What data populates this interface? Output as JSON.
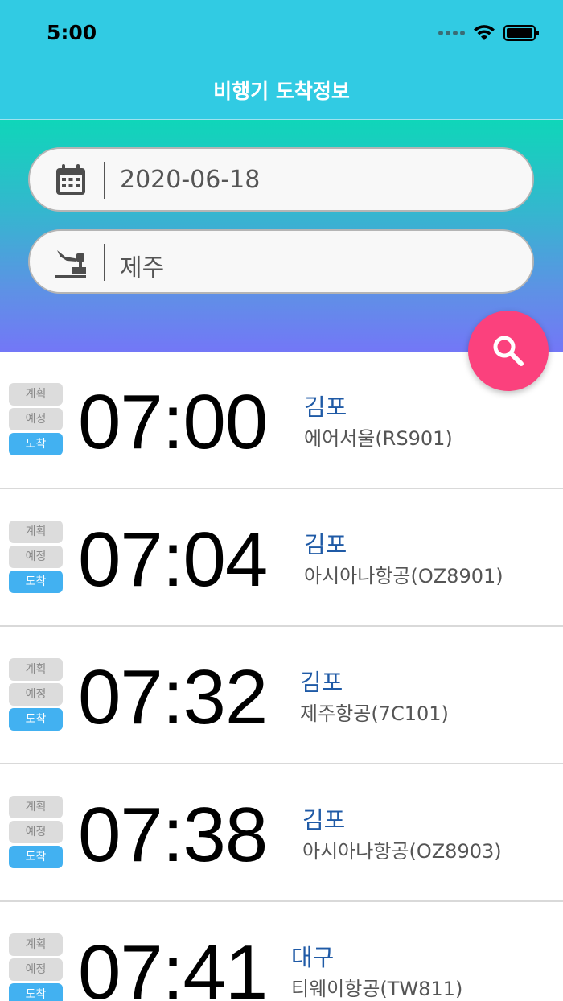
{
  "status_bar": {
    "time": "5:00"
  },
  "nav": {
    "title": "비행기 도착정보"
  },
  "search": {
    "date": "2020-06-18",
    "airport": "제주",
    "date_icon": "calendar-icon",
    "airport_icon": "airplane-arrival-icon",
    "search_icon": "search-icon"
  },
  "colors": {
    "topbar": "#31cbe3",
    "gradient_top": "#0fd6b9",
    "gradient_bottom": "#7377f7",
    "fab": "#fb417d",
    "active_badge": "#42b1f1",
    "city_text": "#1f5aa6"
  },
  "badge_labels": {
    "plan": "계획",
    "expected": "예정",
    "arrived": "도착"
  },
  "flights": [
    {
      "time": "07:00",
      "city": "김포",
      "airline": "에어서울(RS901)",
      "status": "도착"
    },
    {
      "time": "07:04",
      "city": "김포",
      "airline": "아시아나항공(OZ8901)",
      "status": "도착"
    },
    {
      "time": "07:32",
      "city": "김포",
      "airline": "제주항공(7C101)",
      "status": "도착"
    },
    {
      "time": "07:38",
      "city": "김포",
      "airline": "아시아나항공(OZ8903)",
      "status": "도착"
    },
    {
      "time": "07:41",
      "city": "대구",
      "airline": "티웨이항공(TW811)",
      "status": "도착"
    }
  ]
}
